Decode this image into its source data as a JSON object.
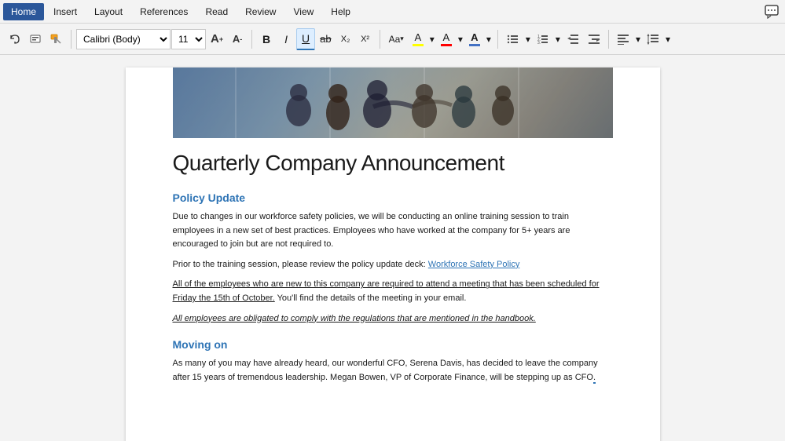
{
  "menubar": {
    "items": [
      {
        "label": "Home",
        "active": true
      },
      {
        "label": "Insert",
        "active": false
      },
      {
        "label": "Layout",
        "active": false
      },
      {
        "label": "References",
        "active": false
      },
      {
        "label": "Read",
        "active": false
      },
      {
        "label": "Review",
        "active": false
      },
      {
        "label": "View",
        "active": false
      },
      {
        "label": "Help",
        "active": false
      }
    ]
  },
  "toolbar": {
    "undo_label": "↩",
    "redo_label": "↪",
    "font_family": "Calibri (Body)",
    "font_size": "11",
    "grow_label": "A",
    "shrink_label": "A",
    "bold_label": "B",
    "italic_label": "I",
    "underline_label": "U",
    "strikethrough_label": "ab",
    "subscript_label": "X₂",
    "superscript_label": "X²",
    "change_case_label": "Aa",
    "highlight_label": "A",
    "font_color_label": "A",
    "char_label": "A",
    "bullets_label": "≡",
    "numbering_label": "≡",
    "outdent_label": "⇐",
    "indent_label": "⇒",
    "align_label": "≡",
    "spacing_label": "↕"
  },
  "document": {
    "title": "Quarterly Company Announcement",
    "sections": [
      {
        "heading": "Policy Update",
        "paragraphs": [
          "Due to changes in our workforce safety policies, we will be conducting an online training session to train employees in a new set of best practices. Employees who have worked at the company for 5+ years are encouraged to join but are not required to.",
          "Prior to the training session, please review the policy update deck: ",
          "All of the employees who are new to this company are required to attend a meeting that has been scheduled for Friday the 15th of October. You'll find the details of the meeting in your email.",
          "All employees are obligated to comply with the regulations that are mentioned in the handbook."
        ],
        "link_text": "Workforce Safety Policy",
        "underline_text": "All of the employees who are new to this company are required to attend a meeting that has been scheduled for Friday the 15th of October.",
        "italic_underline_text": "All employees are obligated to comply with the regulations that are mentioned in the handbook."
      },
      {
        "heading": "Moving on",
        "paragraphs": [
          "As many of you may have already heard, our wonderful CFO, Serena Davis, has decided to leave the company after 15 years of tremendous leadership. Megan Bowen, VP of Corporate Finance, will be stepping up as CFO"
        ]
      }
    ]
  }
}
